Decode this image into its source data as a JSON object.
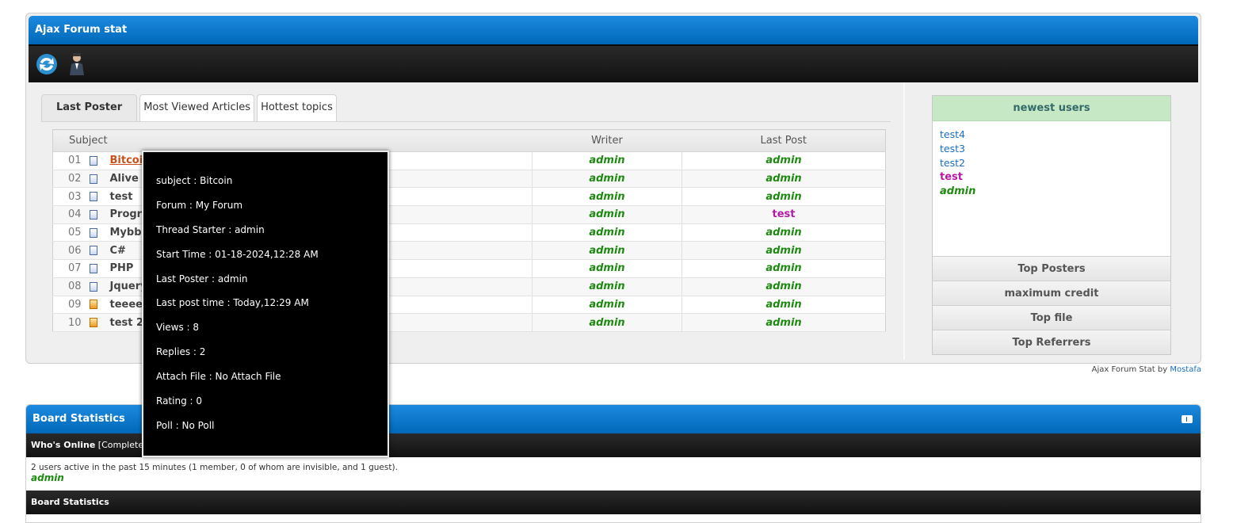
{
  "afs": {
    "title": "Ajax Forum stat",
    "tools": [
      {
        "icon": "refresh-icon"
      },
      {
        "icon": "user-agent-icon"
      }
    ],
    "tabs": [
      "Last Poster",
      "Most Viewed Articles",
      "Hottest topics"
    ],
    "columns": {
      "subject": "Subject",
      "writer": "Writer",
      "last_post": "Last Post"
    },
    "rows": [
      {
        "num": "01",
        "subject": "Bitcoin",
        "writer": "admin",
        "last": "admin"
      },
      {
        "num": "02",
        "subject": "Alive",
        "writer": "admin",
        "last": "admin"
      },
      {
        "num": "03",
        "subject": "test",
        "writer": "admin",
        "last": "admin"
      },
      {
        "num": "04",
        "subject": "Progra",
        "writer": "admin",
        "last": "test"
      },
      {
        "num": "05",
        "subject": "Mybb",
        "writer": "admin",
        "last": "admin"
      },
      {
        "num": "06",
        "subject": "C#",
        "writer": "admin",
        "last": "admin"
      },
      {
        "num": "07",
        "subject": "PHP",
        "writer": "admin",
        "last": "admin"
      },
      {
        "num": "08",
        "subject": "Jquery",
        "writer": "admin",
        "last": "admin"
      },
      {
        "num": "09",
        "subject": "teeeee",
        "writer": "admin",
        "last": "admin"
      },
      {
        "num": "10",
        "subject": "test 2",
        "writer": "admin",
        "last": "admin"
      }
    ],
    "side": {
      "title": "newest users",
      "users": [
        "test4",
        "test3",
        "test2",
        "test",
        "admin"
      ],
      "buttons": [
        "Top Posters",
        "maximum credit",
        "Top file",
        "Top Referrers"
      ]
    },
    "credit": {
      "prefix": "Ajax Forum Stat by",
      "author": "Mostafa"
    }
  },
  "tooltip": [
    "subject : Bitcoin",
    "Forum : My Forum",
    "Thread Starter : admin",
    "Start Time : 01-18-2024,12:28 AM",
    "Last Poster : admin",
    "Last post time : Today,12:29 AM",
    "Views : 8",
    "Replies : 2",
    "Attach File : No Attach File",
    "Rating : 0",
    "Poll : No Poll"
  ],
  "board": {
    "title": "Board Statistics",
    "whos_online": "Who's Online",
    "complete_list": "[Complete Lis",
    "active_text": "2 users active in the past 15 minutes (1 member, 0 of whom are invisible, and 1 guest).",
    "online_user": "admin",
    "stats_heading": "Board Statistics"
  }
}
